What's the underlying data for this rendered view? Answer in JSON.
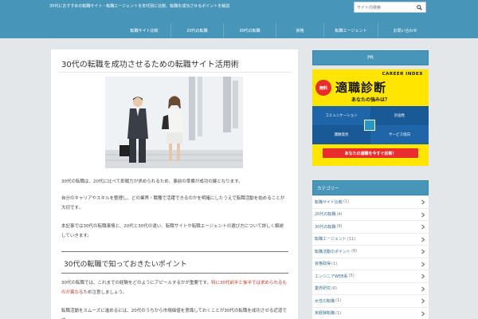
{
  "header": {
    "description": "30代におすすめの転職サイト・転職エージェントを年代別に比較、転職を成功させるポイントを解説",
    "search_placeholder": "サイト内検索"
  },
  "nav": {
    "items": [
      {
        "label": "転職サイト比較"
      },
      {
        "label": "20代の転職"
      },
      {
        "label": "30代の転職"
      },
      {
        "label": "資格"
      },
      {
        "label": "転職エージェント"
      },
      {
        "label": "お問い合わせ"
      }
    ]
  },
  "article": {
    "title": "30代の転職を成功させるための転職サイト活用術",
    "paragraphs": {
      "p1": "30代の転職は、20代に比べて即戦力が求められるため、事前の準備が成功の鍵となります。",
      "p2": "自分のキャリアやスキルを整理し、どの業界・職種で活躍できるのかを明確にしたうえで転職活動を始めることが大切です。",
      "p3": "本記事では30代の転職事情と、20代と30代の違い、転職サイトや転職エージェントの選び方について詳しく解説していきます。",
      "p4_before": "30代の転職では、これまでの経験をどのようにアピールするかが重要です。",
      "p4_red": "特に30代前半と後半では求められるものが異なる",
      "p4_after": "ため注意しましょう。",
      "p5": "転職活動をスムーズに進めるには、20代のうちから市場価値を意識しておくことが30代の転職を成功させる近道です。"
    },
    "section_title": "30代の転職で知っておきたいポイント"
  },
  "sidebar": {
    "pr_label": "PR",
    "ad": {
      "brand": "CAREER INDEX",
      "free_badge": "無料",
      "headline": "適職診断",
      "subheadline": "あなたの強みは？",
      "cells": [
        "コミュニケーション",
        "計画性",
        "課題発見",
        "サービス指向"
      ],
      "cta": "あなたの適職を今すぐ診断！"
    },
    "categories_header": "カテゴリー",
    "categories": [
      {
        "label": "転職サイト比較",
        "count": "(1)"
      },
      {
        "label": "20代の転職",
        "count": "(4)"
      },
      {
        "label": "30代の転職",
        "count": "(9)"
      },
      {
        "label": "転職エージェント",
        "count": "(11)"
      },
      {
        "label": "転職活動のポイント",
        "count": "(6)"
      },
      {
        "label": "資格取得",
        "count": "(1)"
      },
      {
        "label": "エンジニアWEB系",
        "count": "(5)"
      },
      {
        "label": "業界研究",
        "count": "(6)"
      },
      {
        "label": "女性の転職",
        "count": "(1)"
      },
      {
        "label": "未経験転職",
        "count": "(1)"
      }
    ]
  },
  "colors": {
    "header_bg": "#4796b9",
    "page_bg": "#e4e7e9",
    "accent_red": "#c0392b",
    "ad_yellow": "#ffe500"
  }
}
